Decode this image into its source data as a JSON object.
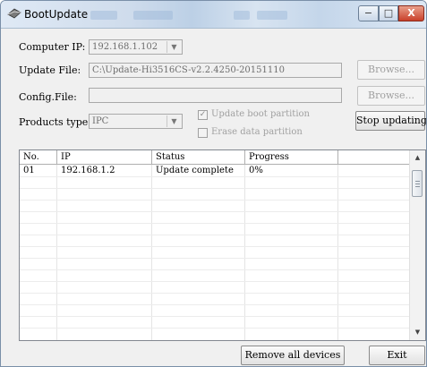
{
  "window": {
    "title": "BootUpdate",
    "minimize_glyph": "−",
    "maximize_glyph": "□",
    "close_glyph": "X"
  },
  "form": {
    "computer_ip": {
      "label": "Computer IP:",
      "value": "192.168.1.102"
    },
    "update_file": {
      "label": "Update File:",
      "value": "C:\\Update-Hi3516CS-v2.2.4250-20151110",
      "browse_label": "Browse..."
    },
    "config_file": {
      "label": "Config.File:",
      "value": "",
      "browse_label": "Browse..."
    },
    "products_type": {
      "label": "Products type:",
      "value": "IPC"
    },
    "update_boot_partition": {
      "label": "Update boot partition",
      "checked": true
    },
    "erase_data_partition": {
      "label": "Erase data partition",
      "checked": false
    },
    "stop_button_label": "Stop updating"
  },
  "devices_table": {
    "columns": [
      "No.",
      "IP",
      "Status",
      "Progress",
      ""
    ],
    "rows": [
      {
        "no": "01",
        "ip": "192.168.1.2",
        "status": "Update complete",
        "progress": "0%"
      }
    ]
  },
  "footer": {
    "remove_all_label": "Remove all devices",
    "exit_label": "Exit"
  }
}
